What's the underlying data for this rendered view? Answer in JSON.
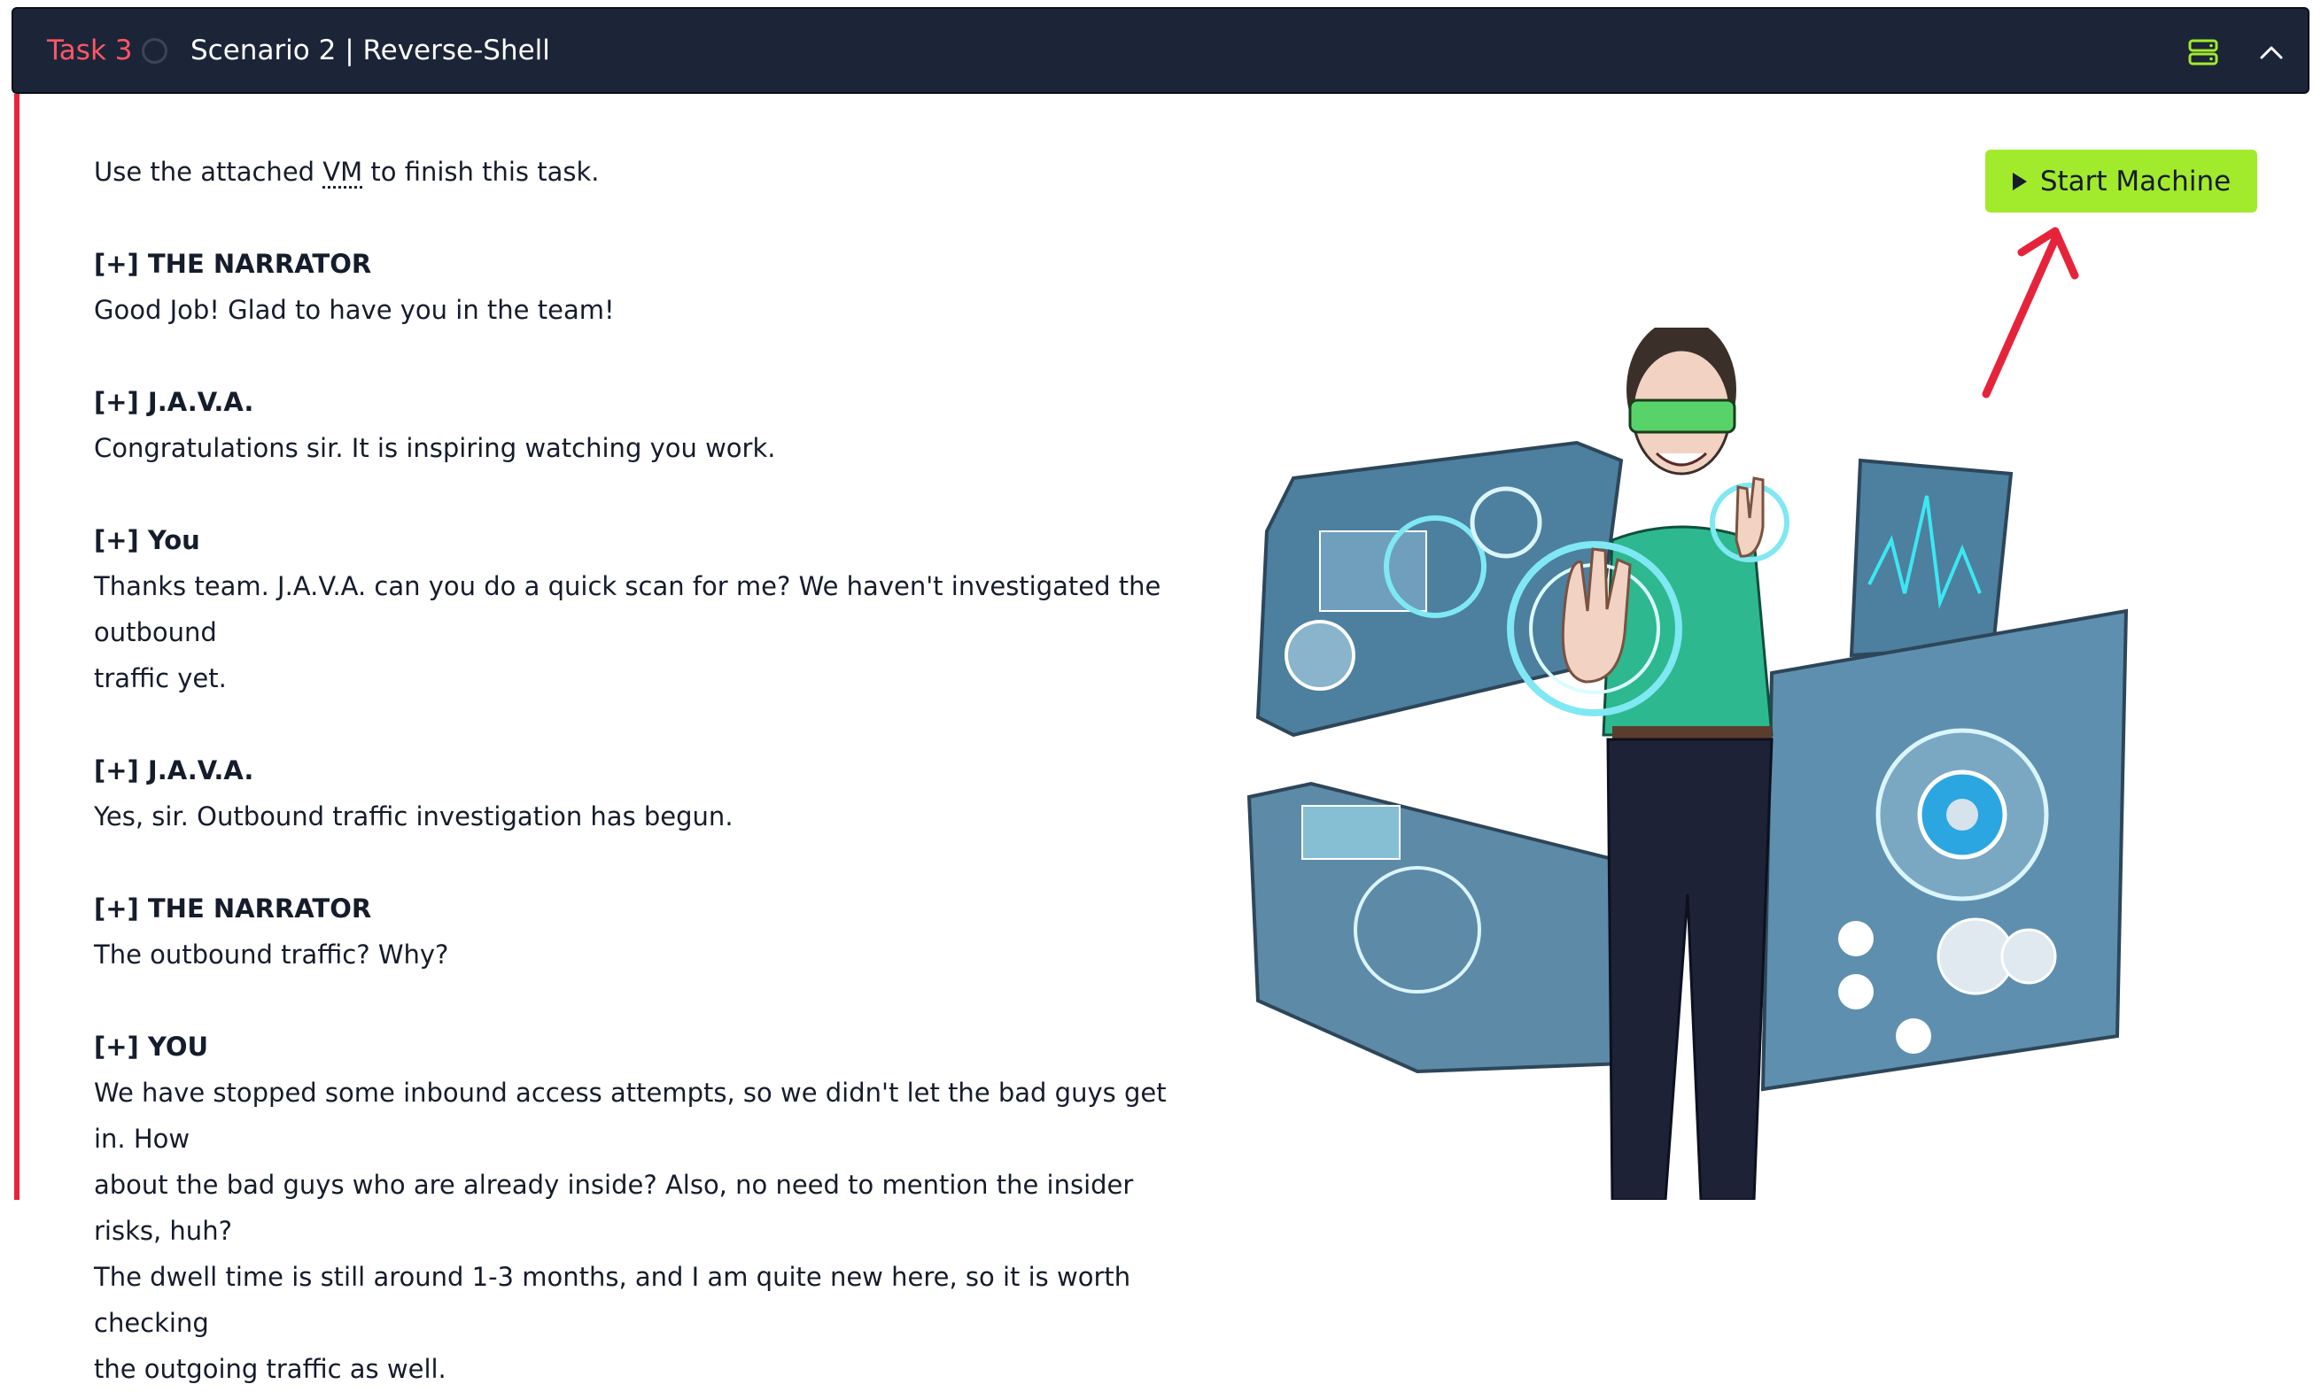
{
  "task": {
    "label": "Task 3",
    "title": "Scenario 2 | Reverse-Shell"
  },
  "header": {
    "server_icon": "server-icon",
    "collapse_icon": "chevron-up-icon"
  },
  "intro": {
    "prefix": "Use the attached ",
    "abbr": "VM",
    "suffix": " to finish this task."
  },
  "dialogue": [
    {
      "speaker": "[+] THE NARRATOR",
      "lines": [
        "Good Job! Glad to have you in the team!"
      ]
    },
    {
      "speaker": "[+] J.A.V.A.",
      "lines": [
        "Congratulations sir. It is inspiring watching you work."
      ]
    },
    {
      "speaker": "[+] You",
      "lines": [
        "Thanks team. J.A.V.A. can you do a quick scan for me? We haven't investigated the outbound",
        "traffic yet."
      ]
    },
    {
      "speaker": "[+] J.A.V.A.",
      "lines": [
        "Yes, sir. Outbound traffic investigation has begun."
      ]
    },
    {
      "speaker": "[+] THE NARRATOR",
      "lines": [
        "The outbound traffic? Why?"
      ]
    },
    {
      "speaker": "[+] YOU",
      "lines": [
        "We have stopped some inbound access attempts, so we didn't let the bad guys get in. How",
        "about the bad guys who are already inside? Also, no need to mention the insider risks, huh?",
        "The dwell time is still around 1-3 months, and I am quite new here, so it is worth checking",
        "the outgoing traffic as well."
      ]
    }
  ],
  "start_machine": {
    "label": "Start Machine",
    "icon": "play-icon",
    "color": "#a2ea2c"
  },
  "colors": {
    "header_bg": "#1c2538",
    "task_label": "#ff5667",
    "accent_border": "#e5243b",
    "annotation_arrow": "#e5243b",
    "server_icon": "#a2ea2c"
  }
}
